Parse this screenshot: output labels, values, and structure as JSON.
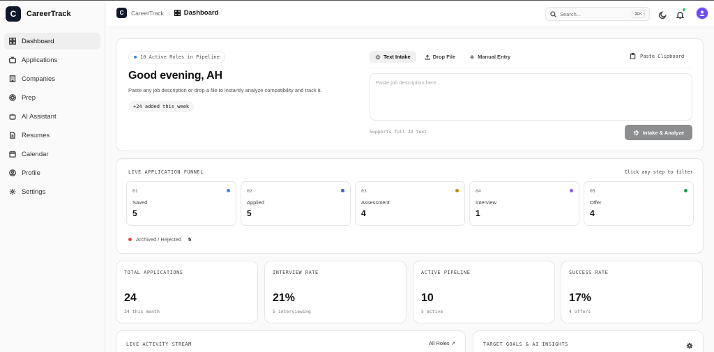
{
  "brand": {
    "logo_letter": "C",
    "name": "CareerTrack"
  },
  "sidebar": {
    "items": [
      {
        "label": "Dashboard",
        "icon": "grid-icon"
      },
      {
        "label": "Applications",
        "icon": "briefcase-icon"
      },
      {
        "label": "Companies",
        "icon": "building-icon"
      },
      {
        "label": "Prep",
        "icon": "target-icon"
      },
      {
        "label": "AI Assistant",
        "icon": "bot-icon"
      },
      {
        "label": "Resumes",
        "icon": "document-icon"
      },
      {
        "label": "Calendar",
        "icon": "calendar-icon"
      },
      {
        "label": "Profile",
        "icon": "user-icon"
      },
      {
        "label": "Settings",
        "icon": "gear-icon"
      }
    ]
  },
  "topbar": {
    "crumb_logo": "C",
    "crumb_root": "CareerTrack",
    "crumb_current": "Dashboard",
    "search_placeholder": "Search...",
    "search_shortcut": "⌘K"
  },
  "hero": {
    "pill_text": "10 Active Roles in Pipeline",
    "greeting": "Good evening, AH",
    "subtitle": "Paste any job description or drop a file to instantly analyze compatibility and track it.",
    "added_badge": "+24 added this week",
    "tabs": [
      "Text Intake",
      "Drop File",
      "Manual Entry"
    ],
    "paste_label": "Paste Clipboard",
    "textarea_placeholder": "Paste job description here...",
    "supports_text": "Supports full JD text",
    "analyze_label": "Intake & Analyze"
  },
  "funnel": {
    "title": "LIVE APPLICATION FUNNEL",
    "hint": "Click any step to filter",
    "stages": [
      {
        "num": "01",
        "name": "Saved",
        "count": "5",
        "color": "#3b82f6"
      },
      {
        "num": "02",
        "name": "Applied",
        "count": "5",
        "color": "#2563eb"
      },
      {
        "num": "03",
        "name": "Assessment",
        "count": "4",
        "color": "#ca8a04"
      },
      {
        "num": "04",
        "name": "Interview",
        "count": "1",
        "color": "#8b5cf6"
      },
      {
        "num": "05",
        "name": "Offer",
        "count": "4",
        "color": "#16a34a"
      }
    ],
    "archived_label": "Archived / Rejected",
    "archived_count": "5",
    "archived_color": "#ef4444"
  },
  "stats": [
    {
      "label": "TOTAL APPLICATIONS",
      "value": "24",
      "sub": "24 this month"
    },
    {
      "label": "INTERVIEW RATE",
      "value": "21%",
      "sub": "5 interviewing"
    },
    {
      "label": "ACTIVE PIPELINE",
      "value": "10",
      "sub": "5 active"
    },
    {
      "label": "SUCCESS RATE",
      "value": "17%",
      "sub": "4 offers"
    }
  ],
  "bottom": {
    "activity_title": "LIVE ACTIVITY STREAM",
    "all_roles": "All Roles ↗",
    "goals_title": "TARGET GOALS & AI INSIGHTS"
  }
}
